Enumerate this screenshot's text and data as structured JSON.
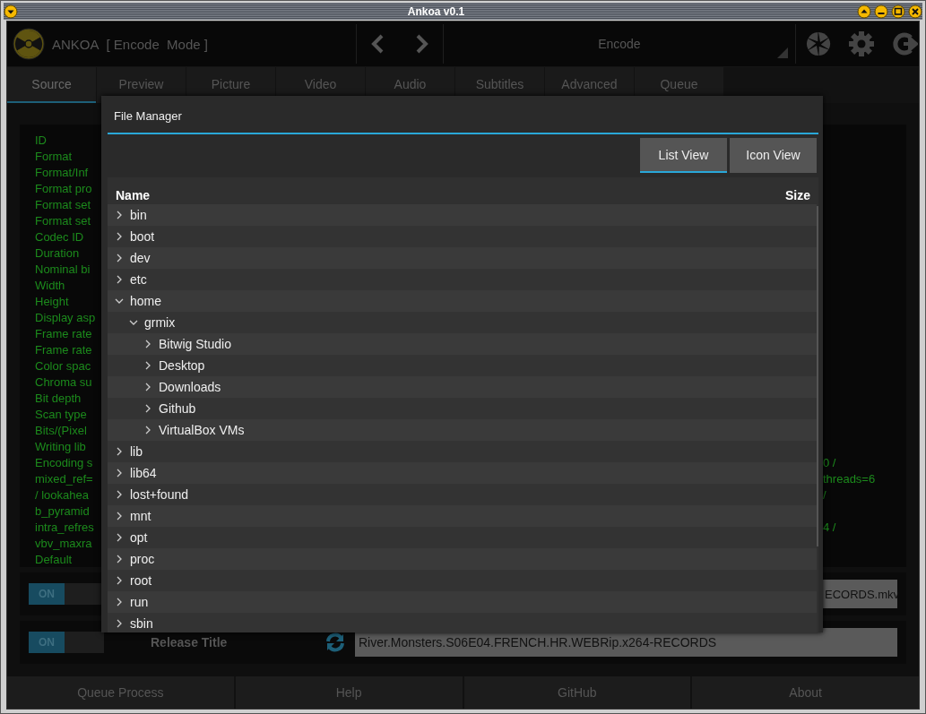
{
  "window": {
    "title": "Ankoa v0.1"
  },
  "header": {
    "app_name": "ANKOA",
    "mode": "[ Encode  Mode ]",
    "preset": "Encode"
  },
  "tabs": [
    {
      "label": "Source",
      "selected": true
    },
    {
      "label": "Preview",
      "selected": false
    },
    {
      "label": "Picture",
      "selected": false
    },
    {
      "label": "Video",
      "selected": false
    },
    {
      "label": "Audio",
      "selected": false
    },
    {
      "label": "Subtitles",
      "selected": false
    },
    {
      "label": "Advanced",
      "selected": false
    },
    {
      "label": "Queue",
      "selected": false
    }
  ],
  "media_info": [
    {
      "label": "ID"
    },
    {
      "label": "Format"
    },
    {
      "label": "Format/Inf"
    },
    {
      "label": "Format pro"
    },
    {
      "label": "Format set"
    },
    {
      "label": "Format set"
    },
    {
      "label": "Codec ID"
    },
    {
      "label": "Duration"
    },
    {
      "label": "Nominal bi"
    },
    {
      "label": "Width"
    },
    {
      "label": "Height"
    },
    {
      "label": "Display asp"
    },
    {
      "label": "Frame rate"
    },
    {
      "label": "Frame rate"
    },
    {
      "label": "Color spac"
    },
    {
      "label": "Chroma su"
    },
    {
      "label": "Bit depth"
    },
    {
      "label": "Scan type"
    },
    {
      "label": "Bits/(Pixel"
    },
    {
      "label": "Writing lib"
    },
    {
      "label": "Encoding s",
      "value": "0 /"
    },
    {
      "label": "mixed_ref=",
      "value": "threads=6"
    },
    {
      "label": "/ lookahea",
      "value": "/"
    },
    {
      "label": "b_pyramid"
    },
    {
      "label": "intra_refres",
      "value": "4 /"
    },
    {
      "label": "vbv_maxra"
    },
    {
      "label": "Default"
    }
  ],
  "filename_row": {
    "toggle": {
      "label": "ON",
      "on": true
    },
    "value": "ECORDS.mkv"
  },
  "release_row": {
    "toggle": {
      "label": "ON",
      "on": true
    },
    "label": "Release Title",
    "value": "River.Monsters.S06E04.FRENCH.HR.WEBRip.x264-RECORDS"
  },
  "file_manager": {
    "title": "File Manager",
    "view_buttons": [
      {
        "label": "List View",
        "selected": true
      },
      {
        "label": "Icon View",
        "selected": false
      }
    ],
    "columns": [
      "Name",
      "Size"
    ],
    "tree": [
      {
        "name": "bin",
        "expanded": false
      },
      {
        "name": "boot",
        "expanded": false
      },
      {
        "name": "dev",
        "expanded": false
      },
      {
        "name": "etc",
        "expanded": false
      },
      {
        "name": "home",
        "expanded": true,
        "children": [
          {
            "name": "grmix",
            "expanded": true,
            "children": [
              {
                "name": "Bitwig Studio",
                "expanded": false
              },
              {
                "name": "Desktop",
                "expanded": false
              },
              {
                "name": "Downloads",
                "expanded": false
              },
              {
                "name": "Github",
                "expanded": false
              },
              {
                "name": "VirtualBox VMs",
                "expanded": false
              }
            ]
          }
        ]
      },
      {
        "name": "lib",
        "expanded": false
      },
      {
        "name": "lib64",
        "expanded": false
      },
      {
        "name": "lost+found",
        "expanded": false
      },
      {
        "name": "mnt",
        "expanded": false
      },
      {
        "name": "opt",
        "expanded": false
      },
      {
        "name": "proc",
        "expanded": false
      },
      {
        "name": "root",
        "expanded": false
      },
      {
        "name": "run",
        "expanded": false
      },
      {
        "name": "sbin",
        "expanded": false
      }
    ]
  },
  "footer_buttons": [
    "Queue Process",
    "Help",
    "GitHub",
    "About"
  ]
}
